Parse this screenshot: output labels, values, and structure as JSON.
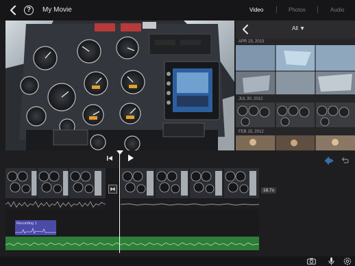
{
  "topbar": {
    "project_title": "My Movie",
    "help_symbol": "?",
    "tabs": [
      {
        "label": "Video",
        "active": true
      },
      {
        "label": "Photos",
        "active": false
      },
      {
        "label": "Audio",
        "active": false
      }
    ]
  },
  "browser": {
    "filter_label": "All ▼",
    "sections": [
      {
        "date": "APR 23, 2013"
      },
      {
        "date": "JUL 30, 2012"
      },
      {
        "date": "FEB 15, 2012"
      }
    ]
  },
  "timeline": {
    "transition_symbol": "⧓",
    "duration": "18.7s",
    "recording_label": "Recording 1"
  },
  "colors": {
    "accent_blue": "#4aa3ff",
    "recording_purple": "#4b4aa6",
    "music_green": "#2f7d39",
    "background": "#1c1c1e"
  },
  "icons": {
    "back": "chevron-left-icon",
    "help": "question-circle-icon",
    "play": "play-icon",
    "skip": "skip-to-start-icon",
    "waveform": "audio-waveform-icon",
    "undo": "undo-icon",
    "camera": "camera-icon",
    "mic": "microphone-icon",
    "settings": "settings-gear-icon"
  }
}
